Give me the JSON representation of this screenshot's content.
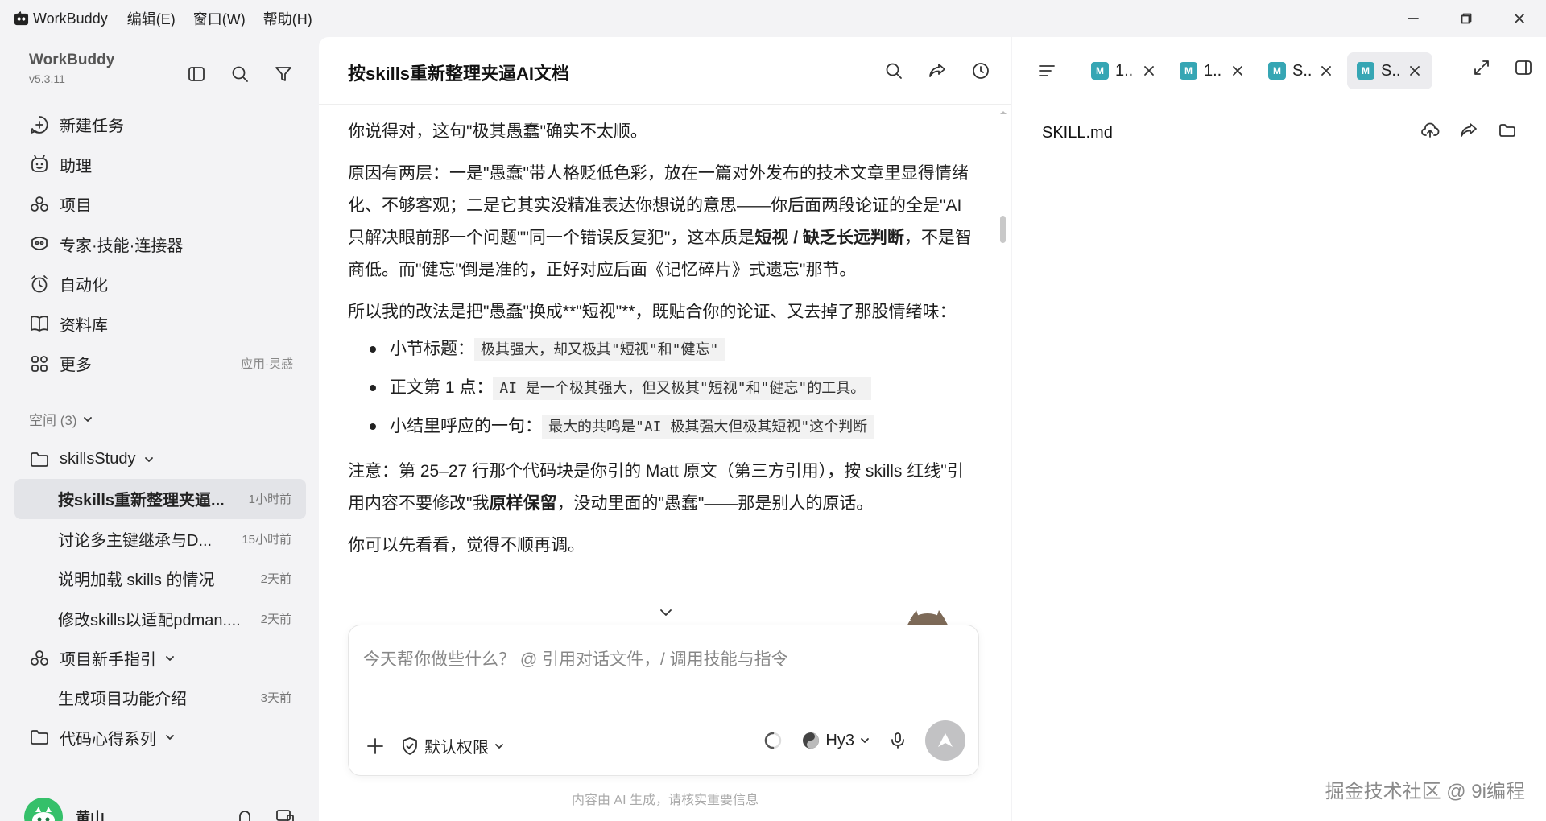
{
  "titlebar": {
    "app_name": "WorkBuddy",
    "menus": [
      "编辑(E)",
      "窗口(W)",
      "帮助(H)"
    ]
  },
  "sidebar": {
    "title": "WorkBuddy",
    "version": "v5.3.11",
    "nav": [
      {
        "label": "新建任务",
        "icon": "new-task-icon"
      },
      {
        "label": "助理",
        "icon": "assistant-icon"
      },
      {
        "label": "项目",
        "icon": "project-icon"
      },
      {
        "label": "专家·技能·连接器",
        "icon": "expert-skill-icon"
      },
      {
        "label": "自动化",
        "icon": "alarm-clock-icon"
      },
      {
        "label": "资料库",
        "icon": "book-icon"
      },
      {
        "label": "更多",
        "icon": "apps-icon",
        "extra": "应用·灵感"
      }
    ],
    "space_header": "空间 (3)",
    "folders": [
      {
        "label": "skillsStudy",
        "tasks": [
          {
            "name": "按skills重新整理夹逼...",
            "time": "1小时前",
            "active": true
          },
          {
            "name": "讨论多主键继承与D...",
            "time": "15小时前"
          },
          {
            "name": "说明加载 skills 的情况",
            "time": "2天前"
          },
          {
            "name": "修改skills以适配pdman....",
            "time": "2天前"
          }
        ]
      },
      {
        "label": "项目新手指引",
        "tasks": [
          {
            "name": "生成项目功能介绍",
            "time": "3天前"
          }
        ]
      },
      {
        "label": "代码心得系列"
      }
    ],
    "user": {
      "name": "黄山"
    }
  },
  "chat": {
    "title": "按skills重新整理夹逼AI文档",
    "message": {
      "p1": "你说得对，这句\"极其愚蠢\"确实不太顺。",
      "p2_a": "原因有两层：一是\"愚蠢\"带人格贬低色彩，放在一篇对外发布的技术文章里显得情绪化、不够客观；二是它其实没精准表达你想说的意思——你后面两段论证的全是\"AI 只解决眼前那一个问题\"\"同一个错误反复犯\"，这本质是",
      "p2_bold": "短视 / 缺乏长远判断",
      "p2_b": "，不是智商低。而\"健忘\"倒是准的，正好对应后面《记忆碎片》式遗忘\"那节。",
      "p3": "所以我的改法是把\"愚蠢\"换成**\"短视\"**，既贴合你的论证、又去掉了那股情绪味：",
      "bullets": [
        {
          "label": "小节标题：",
          "code": "极其强大，却又极其\"短视\"和\"健忘\""
        },
        {
          "label": "正文第 1 点：",
          "code": "AI 是一个极其强大，但又极其\"短视\"和\"健忘\"的工具。"
        },
        {
          "label": "小结里呼应的一句：",
          "code": "最大的共鸣是\"AI 极其强大但极其短视\"这个判断"
        }
      ],
      "p4_a": "注意：第 25–27 行那个代码块是你引的 Matt 原文（第三方引用），按 skills 红线\"引用内容不要修改\"我",
      "p4_bold": "原样保留",
      "p4_b": "，没动里面的\"愚蠢\"——那是别人的原话。",
      "p5": "你可以先看看，觉得不顺再调。"
    },
    "input_placeholder": "今天帮你做些什么？ @ 引用对话文件，/ 调用技能与指令",
    "permission": "默认权限",
    "model": "Hy3",
    "disclaimer": "内容由 AI 生成，请核实重要信息"
  },
  "preview": {
    "tabs": [
      {
        "label": "1..",
        "active": false
      },
      {
        "label": "1..",
        "active": false
      },
      {
        "label": "S..",
        "active": false
      },
      {
        "label": "S..",
        "active": true
      }
    ],
    "file_name": "SKILL.md",
    "watermark": "掘金技术社区 @ 9i编程"
  },
  "colors": {
    "accent_markdown": "#36a6b4",
    "avatar_green": "#35c06a",
    "send_disabled": "#c2c2c4"
  }
}
